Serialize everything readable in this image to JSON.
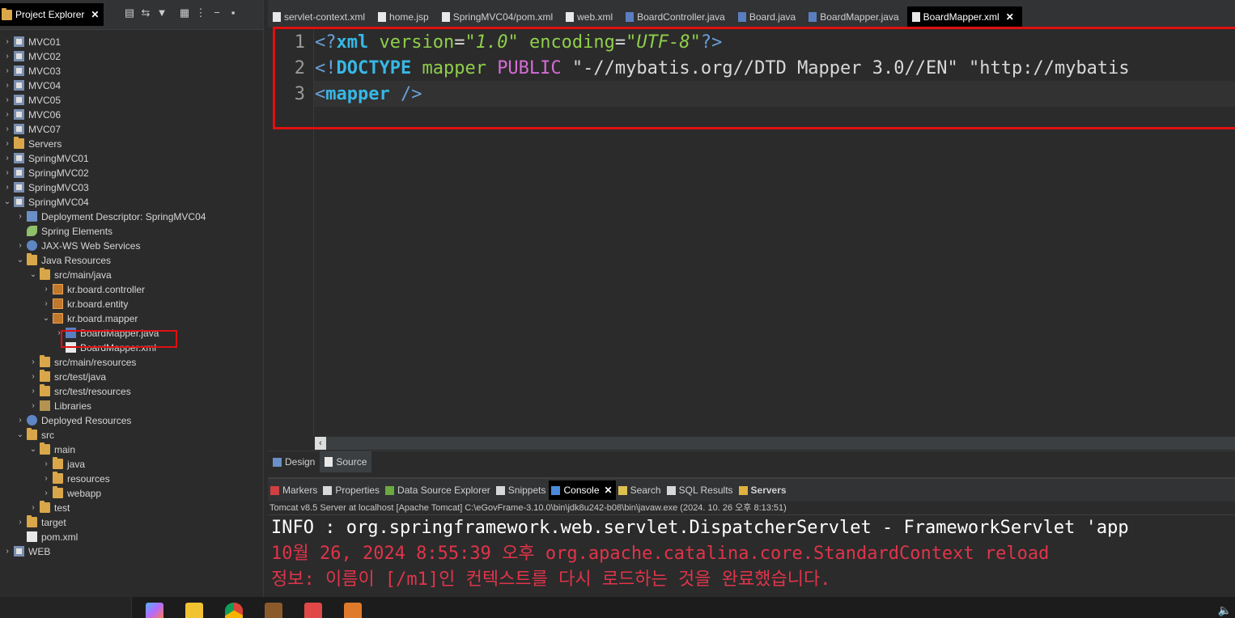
{
  "explorer": {
    "title": "Project Explorer",
    "toolbar": [
      "collapse-all-icon",
      "link-with-editor-icon",
      "filter-icon",
      "view-menu-icon",
      "more-icon",
      "minimize-icon",
      "maximize-icon"
    ],
    "tree": [
      {
        "label": "MVC01",
        "icon": "project-icon",
        "depth": 0,
        "arrow": "›"
      },
      {
        "label": "MVC02",
        "icon": "project-icon",
        "depth": 0,
        "arrow": "›"
      },
      {
        "label": "MVC03",
        "icon": "project-icon",
        "depth": 0,
        "arrow": "›"
      },
      {
        "label": "MVC04",
        "icon": "project-icon",
        "depth": 0,
        "arrow": "›"
      },
      {
        "label": "MVC05",
        "icon": "project-icon",
        "depth": 0,
        "arrow": "›"
      },
      {
        "label": "MVC06",
        "icon": "project-icon",
        "depth": 0,
        "arrow": "›"
      },
      {
        "label": "MVC07",
        "icon": "project-icon",
        "depth": 0,
        "arrow": "›"
      },
      {
        "label": "Servers",
        "icon": "folder-icon",
        "depth": 0,
        "arrow": "›"
      },
      {
        "label": "SpringMVC01",
        "icon": "project-icon",
        "depth": 0,
        "arrow": "›"
      },
      {
        "label": "SpringMVC02",
        "icon": "project-icon",
        "depth": 0,
        "arrow": "›"
      },
      {
        "label": "SpringMVC03",
        "icon": "project-icon",
        "depth": 0,
        "arrow": "›"
      },
      {
        "label": "SpringMVC04",
        "icon": "project-icon",
        "depth": 0,
        "arrow": "⌄"
      },
      {
        "label": "Deployment Descriptor: SpringMVC04",
        "icon": "descriptor-icon",
        "depth": 1,
        "arrow": "›"
      },
      {
        "label": "Spring Elements",
        "icon": "spring-leaf-icon",
        "depth": 1,
        "arrow": ""
      },
      {
        "label": "JAX-WS Web Services",
        "icon": "web-services-icon",
        "depth": 1,
        "arrow": "›"
      },
      {
        "label": "Java Resources",
        "icon": "java-resources-icon",
        "depth": 1,
        "arrow": "⌄"
      },
      {
        "label": "src/main/java",
        "icon": "source-folder-icon",
        "depth": 2,
        "arrow": "⌄"
      },
      {
        "label": "kr.board.controller",
        "icon": "package-icon",
        "depth": 3,
        "arrow": "›"
      },
      {
        "label": "kr.board.entity",
        "icon": "package-icon",
        "depth": 3,
        "arrow": "›"
      },
      {
        "label": "kr.board.mapper",
        "icon": "package-icon",
        "depth": 3,
        "arrow": "⌄"
      },
      {
        "label": "BoardMapper.java",
        "icon": "java-file-icon",
        "depth": 4,
        "arrow": "›"
      },
      {
        "label": "BoardMapper.xml",
        "icon": "xml-file-icon",
        "depth": 4,
        "arrow": ""
      },
      {
        "label": "src/main/resources",
        "icon": "source-folder-icon",
        "depth": 2,
        "arrow": "›"
      },
      {
        "label": "src/test/java",
        "icon": "source-folder-icon",
        "depth": 2,
        "arrow": "›"
      },
      {
        "label": "src/test/resources",
        "icon": "source-folder-icon",
        "depth": 2,
        "arrow": "›"
      },
      {
        "label": "Libraries",
        "icon": "library-icon",
        "depth": 2,
        "arrow": "›"
      },
      {
        "label": "Deployed Resources",
        "icon": "deployed-resources-icon",
        "depth": 1,
        "arrow": "›"
      },
      {
        "label": "src",
        "icon": "folder-icon",
        "depth": 1,
        "arrow": "⌄"
      },
      {
        "label": "main",
        "icon": "folder-icon",
        "depth": 2,
        "arrow": "⌄"
      },
      {
        "label": "java",
        "icon": "folder-icon",
        "depth": 3,
        "arrow": "›"
      },
      {
        "label": "resources",
        "icon": "folder-icon",
        "depth": 3,
        "arrow": "›"
      },
      {
        "label": "webapp",
        "icon": "folder-icon",
        "depth": 3,
        "arrow": "›"
      },
      {
        "label": "test",
        "icon": "folder-icon",
        "depth": 2,
        "arrow": "›"
      },
      {
        "label": "target",
        "icon": "folder-icon",
        "depth": 1,
        "arrow": "›"
      },
      {
        "label": "pom.xml",
        "icon": "maven-file-icon",
        "depth": 1,
        "arrow": ""
      },
      {
        "label": "WEB",
        "icon": "project-icon",
        "depth": 0,
        "arrow": "›"
      }
    ]
  },
  "editor": {
    "tabs": [
      {
        "label": "servlet-context.xml",
        "icon": "xml-file-icon",
        "active": false
      },
      {
        "label": "home.jsp",
        "icon": "jsp-file-icon",
        "active": false
      },
      {
        "label": "SpringMVC04/pom.xml",
        "icon": "maven-file-icon",
        "active": false
      },
      {
        "label": "web.xml",
        "icon": "xml-file-icon",
        "active": false
      },
      {
        "label": "BoardController.java",
        "icon": "java-file-icon",
        "active": false
      },
      {
        "label": "Board.java",
        "icon": "java-file-icon",
        "active": false
      },
      {
        "label": "BoardMapper.java",
        "icon": "java-file-icon",
        "active": false
      },
      {
        "label": "BoardMapper.xml",
        "icon": "xml-file-icon",
        "active": true
      }
    ],
    "line_numbers": [
      "1",
      "2",
      "3"
    ],
    "code": {
      "l1": [
        "<?",
        "xml",
        " version",
        "=",
        "\"1.0\"",
        " encoding",
        "=",
        "\"UTF-8\"",
        "?>"
      ],
      "l2": [
        "<!",
        "DOCTYPE",
        " mapper ",
        "PUBLIC",
        " \"-//mybatis.org//DTD Mapper 3.0//EN\" \"http://mybatis"
      ],
      "l3": [
        "<",
        "mapper",
        " />"
      ]
    },
    "bottom_tabs": [
      {
        "label": "Design",
        "icon": "design-icon"
      },
      {
        "label": "Source",
        "icon": "source-icon"
      }
    ]
  },
  "console": {
    "tabs": [
      {
        "label": "Markers",
        "icon": "markers-icon"
      },
      {
        "label": "Properties",
        "icon": "properties-icon"
      },
      {
        "label": "Data Source Explorer",
        "icon": "data-source-icon"
      },
      {
        "label": "Snippets",
        "icon": "snippets-icon"
      },
      {
        "label": "Console",
        "icon": "console-icon",
        "active": true
      },
      {
        "label": "Search",
        "icon": "search-icon"
      },
      {
        "label": "SQL Results",
        "icon": "sql-results-icon"
      },
      {
        "label": "Servers",
        "icon": "servers-icon",
        "bold": true
      }
    ],
    "info": "Tomcat v8.5 Server at localhost [Apache Tomcat] C:\\eGovFrame-3.10.0\\bin\\jdk8u242-b08\\bin\\javaw.exe  (2024. 10. 26 오후 8:13:51)",
    "lines": [
      {
        "text": "INFO : org.springframework.web.servlet.DispatcherServlet - FrameworkServlet 'app",
        "color": "#ffffff"
      },
      {
        "text": "10월 26, 2024 8:55:39 오후 org.apache.catalina.core.StandardContext reload",
        "color": "#e0344a"
      },
      {
        "text": "정보: 이름이 [/m1]인 컨텍스트를 다시 로드하는 것을 완료했습니다.",
        "color": "#e0344a"
      }
    ]
  },
  "taskbar": {
    "apps": [
      "copilot-icon",
      "file-explorer-icon",
      "chrome-icon",
      "game-app-icon",
      "app-icon",
      "java-app-icon"
    ],
    "tray": [
      "volume-icon"
    ]
  },
  "colors": {
    "highlight_box": "#e01010",
    "tag": "#37b8e6",
    "attr": "#8fce4a",
    "keyword": "#d66cd6"
  }
}
